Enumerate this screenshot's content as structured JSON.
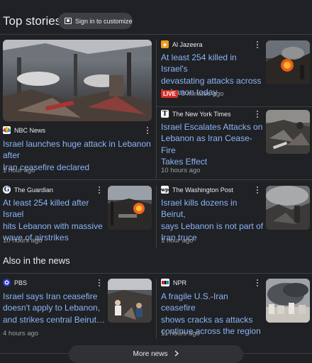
{
  "header": {
    "title": "Top stories",
    "signin_label": "Sign in to customize"
  },
  "top_stories": [
    {
      "source": "NBC News",
      "headline_lines": [
        "Israel launches huge attack in Lebanon after",
        "Iran ceasefire declared"
      ],
      "time": "1 hour ago",
      "thumb_icon": "destroyed-building-photo"
    },
    {
      "source": "Al Jazeera",
      "headline_lines": [
        "At least 254 killed in Israel's",
        "devastating attacks across",
        "Lebanon today"
      ],
      "live_label": "LIVE",
      "time": "8 minutes ago",
      "thumb_icon": "explosion-fire-photo"
    },
    {
      "source": "The New York Times",
      "headline_lines": [
        "Israel Escalates Attacks on",
        "Lebanon as Iran Cease-Fire",
        "Takes Effect"
      ],
      "time": "10 hours ago",
      "thumb_icon": "rubble-photo"
    },
    {
      "source": "The Guardian",
      "headline_lines": [
        "At least 254 killed after Israel",
        "hits Lebanon with massive",
        "wave of airstrikes"
      ],
      "time": "10 hours ago",
      "thumb_icon": "airstrike-fire-photo"
    },
    {
      "source": "The Washington Post",
      "headline_lines": [
        "Israel kills dozens in Beirut,",
        "says Lebanon is not part of",
        "Iran truce"
      ],
      "time": "1 hour ago",
      "thumb_icon": "smoke-ruins-photo"
    }
  ],
  "also_in_news": {
    "title": "Also in the news",
    "items": [
      {
        "source": "PBS",
        "headline_lines": [
          "Israel says Iran ceasefire",
          "doesn't apply to Lebanon,",
          "and strikes central Beirut…"
        ],
        "time": "4 hours ago",
        "thumb_icon": "rescue-scene-photo"
      },
      {
        "source": "NPR",
        "headline_lines": [
          "A fragile U.S.-Iran ceasefire",
          "shows cracks as attacks",
          "continue across the region"
        ],
        "time": "11 hours ago",
        "thumb_icon": "smoke-city-photo"
      }
    ]
  },
  "more_news": {
    "label": "More news",
    "icon": "chevron-right-icon"
  },
  "colors": {
    "background": "#202124",
    "link": "#8ab4f8",
    "live": "#d93025",
    "divider": "#3c4043"
  }
}
